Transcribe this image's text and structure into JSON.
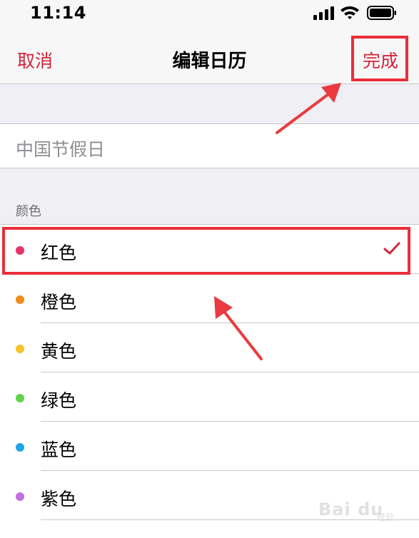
{
  "status_bar": {
    "time": "11:14"
  },
  "nav": {
    "cancel": "取消",
    "title": "编辑日历",
    "done": "完成"
  },
  "calendar": {
    "name": "中国节假日"
  },
  "color_section": {
    "header": "颜色",
    "options": [
      {
        "label": "红色",
        "color": "#e8336a",
        "selected": true
      },
      {
        "label": "橙色",
        "color": "#f28c1b",
        "selected": false
      },
      {
        "label": "黄色",
        "color": "#f7c325",
        "selected": false
      },
      {
        "label": "绿色",
        "color": "#5fd34a",
        "selected": false
      },
      {
        "label": "蓝色",
        "color": "#1ea5e8",
        "selected": false
      },
      {
        "label": "紫色",
        "color": "#c06fe0",
        "selected": false
      }
    ]
  },
  "accent_color": "#d3243b",
  "watermark": {
    "logo": "Bai du",
    "sub": "经验"
  }
}
